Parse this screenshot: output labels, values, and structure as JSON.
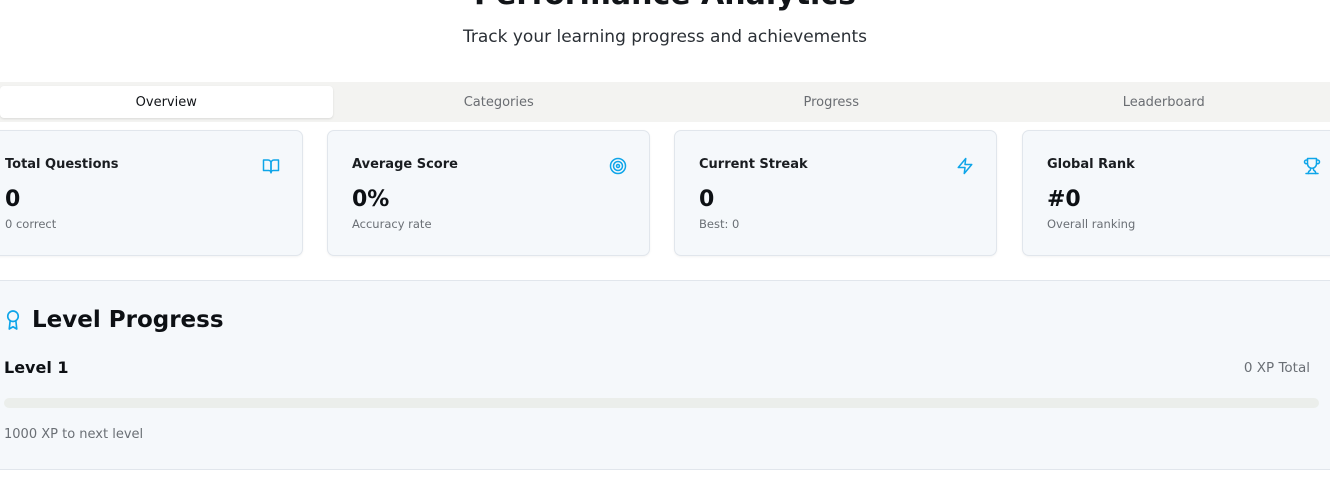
{
  "header": {
    "title": "Performance Analytics",
    "subtitle": "Track your learning progress and achievements"
  },
  "tabs": [
    {
      "label": "Overview",
      "active": true
    },
    {
      "label": "Categories",
      "active": false
    },
    {
      "label": "Progress",
      "active": false
    },
    {
      "label": "Leaderboard",
      "active": false
    }
  ],
  "stats": [
    {
      "label": "Total Questions",
      "value": "0",
      "sub": "0 correct",
      "icon": "book-open-icon"
    },
    {
      "label": "Average Score",
      "value": "0%",
      "sub": "Accuracy rate",
      "icon": "target-icon"
    },
    {
      "label": "Current Streak",
      "value": "0",
      "sub": "Best: 0",
      "icon": "zap-icon"
    },
    {
      "label": "Global Rank",
      "value": "#0",
      "sub": "Overall ranking",
      "icon": "trophy-icon"
    }
  ],
  "level": {
    "title": "Level Progress",
    "label": "Level 1",
    "xp_total": "0 XP Total",
    "next_level": "1000 XP to next level",
    "progress_fraction": 0,
    "icon": "award-icon"
  },
  "colors": {
    "accent": "#0ea5e9",
    "card_bg": "#f5f8fb",
    "tab_bg": "#f3f3f1"
  }
}
